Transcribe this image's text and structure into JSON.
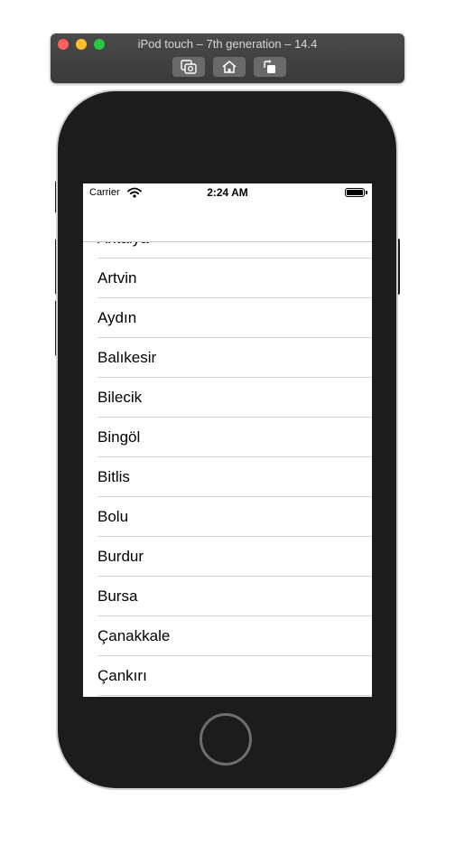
{
  "simulator": {
    "title": "iPod touch – 7th generation – 14.4",
    "buttons": [
      "screenshot-icon",
      "home-icon",
      "rotate-icon"
    ]
  },
  "status_bar": {
    "carrier": "Carrier",
    "time": "2:24 AM"
  },
  "list": {
    "items": [
      "Antalya",
      "Artvin",
      "Aydın",
      "Balıkesir",
      "Bilecik",
      "Bingöl",
      "Bitlis",
      "Bolu",
      "Burdur",
      "Bursa",
      "Çanakkale",
      "Çankırı"
    ]
  }
}
